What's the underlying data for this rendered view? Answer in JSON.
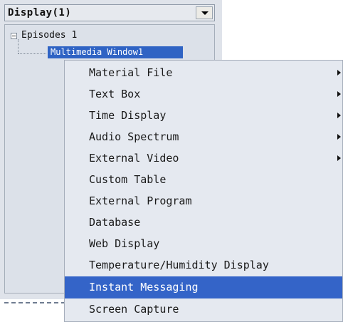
{
  "combo": {
    "label": "Display(1)"
  },
  "tree": {
    "root": "Episodes 1",
    "child": "Multimedia Window1"
  },
  "menu": {
    "items": [
      {
        "label": "Material File",
        "submenu": true
      },
      {
        "label": "Text Box",
        "submenu": true
      },
      {
        "label": "Time Display",
        "submenu": true
      },
      {
        "label": "Audio Spectrum",
        "submenu": true
      },
      {
        "label": "External Video",
        "submenu": true
      },
      {
        "label": "Custom Table",
        "submenu": false
      },
      {
        "label": "External Program",
        "submenu": false
      },
      {
        "label": "Database",
        "submenu": false
      },
      {
        "label": "Web Display",
        "submenu": false
      },
      {
        "label": "Temperature/Humidity Display",
        "submenu": false
      },
      {
        "label": "Instant Messaging",
        "submenu": false,
        "highlighted": true
      },
      {
        "label": "Screen Capture",
        "submenu": false
      }
    ]
  },
  "colors": {
    "highlight": "#3464c8",
    "menu_bg": "#e5e9f0",
    "panel_bg": "#dfe3ea"
  }
}
